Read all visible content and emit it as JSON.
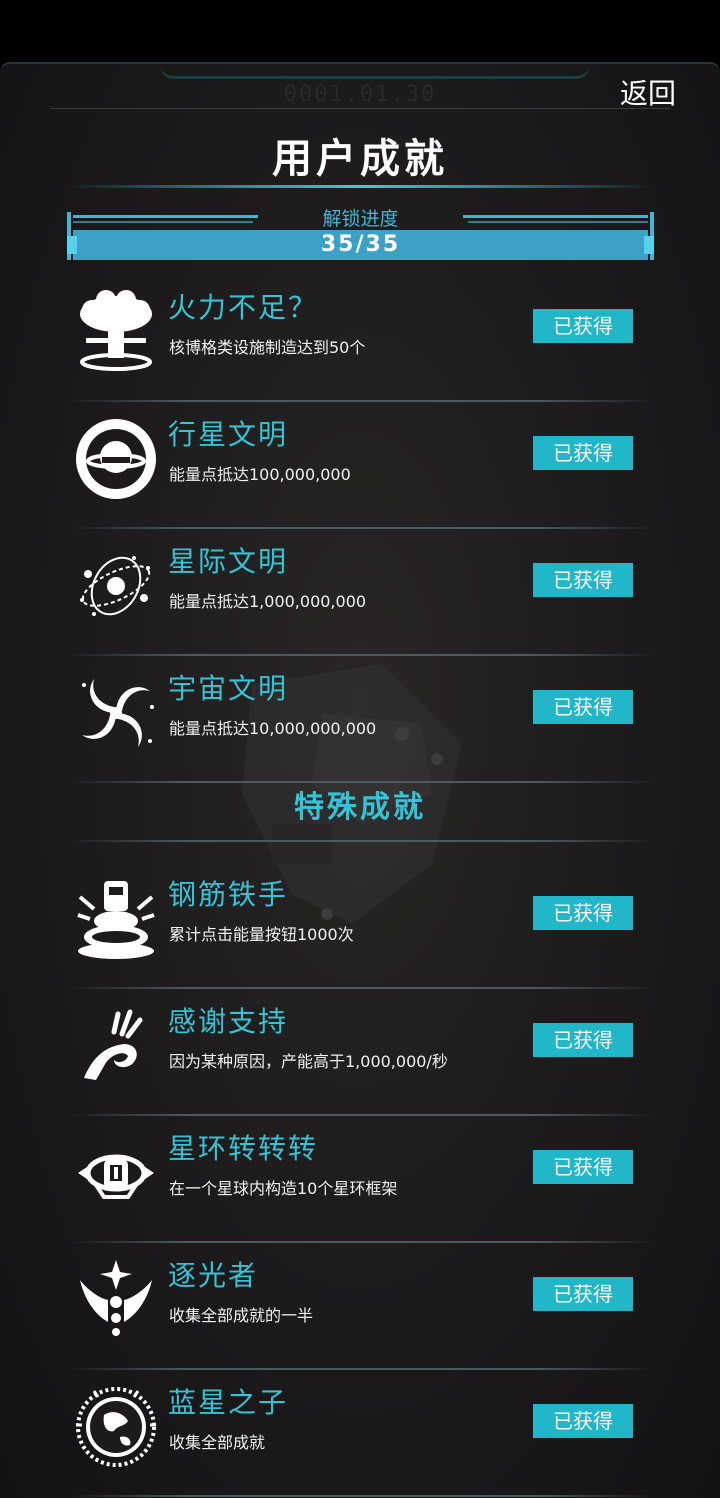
{
  "header": {
    "date": "0001.01.30",
    "back_label": "返回",
    "title": "用户成就"
  },
  "progress": {
    "label": "解锁进度",
    "text": "35/35",
    "fraction": 1.0
  },
  "achievements": [
    {
      "name": "火力不足？",
      "desc": "核博格类设施制造达到50个",
      "status": "已获得",
      "icon": "mushroom-cloud-icon"
    },
    {
      "name": "行星文明",
      "desc": "能量点抵达100,000,000",
      "status": "已获得",
      "icon": "planet-ring-icon"
    },
    {
      "name": "星际文明",
      "desc": "能量点抵达1,000,000,000",
      "status": "已获得",
      "icon": "star-system-icon"
    },
    {
      "name": "宇宙文明",
      "desc": "能量点抵达10,000,000,000",
      "status": "已获得",
      "icon": "galaxy-swirl-icon"
    }
  ],
  "special_title": "特殊成就",
  "special": [
    {
      "name": "钢筋铁手",
      "desc": "累计点击能量按钮1000次",
      "status": "已获得",
      "icon": "press-button-icon"
    },
    {
      "name": "感谢支持",
      "desc": "因为某种原因，产能高于1,000,000/秒",
      "status": "已获得",
      "icon": "ok-hand-icon"
    },
    {
      "name": "星环转转转",
      "desc": "在一个星球内构造10个星环框架",
      "status": "已获得",
      "icon": "ring-station-icon"
    },
    {
      "name": "逐光者",
      "desc": "收集全部成就的一半",
      "status": "已获得",
      "icon": "winged-star-icon"
    },
    {
      "name": "蓝星之子",
      "desc": "收集全部成就",
      "status": "已获得",
      "icon": "earth-emblem-icon"
    }
  ],
  "colors": {
    "accent": "#35c3d6",
    "button": "#21b6c8",
    "background": "#1c1a1b"
  }
}
